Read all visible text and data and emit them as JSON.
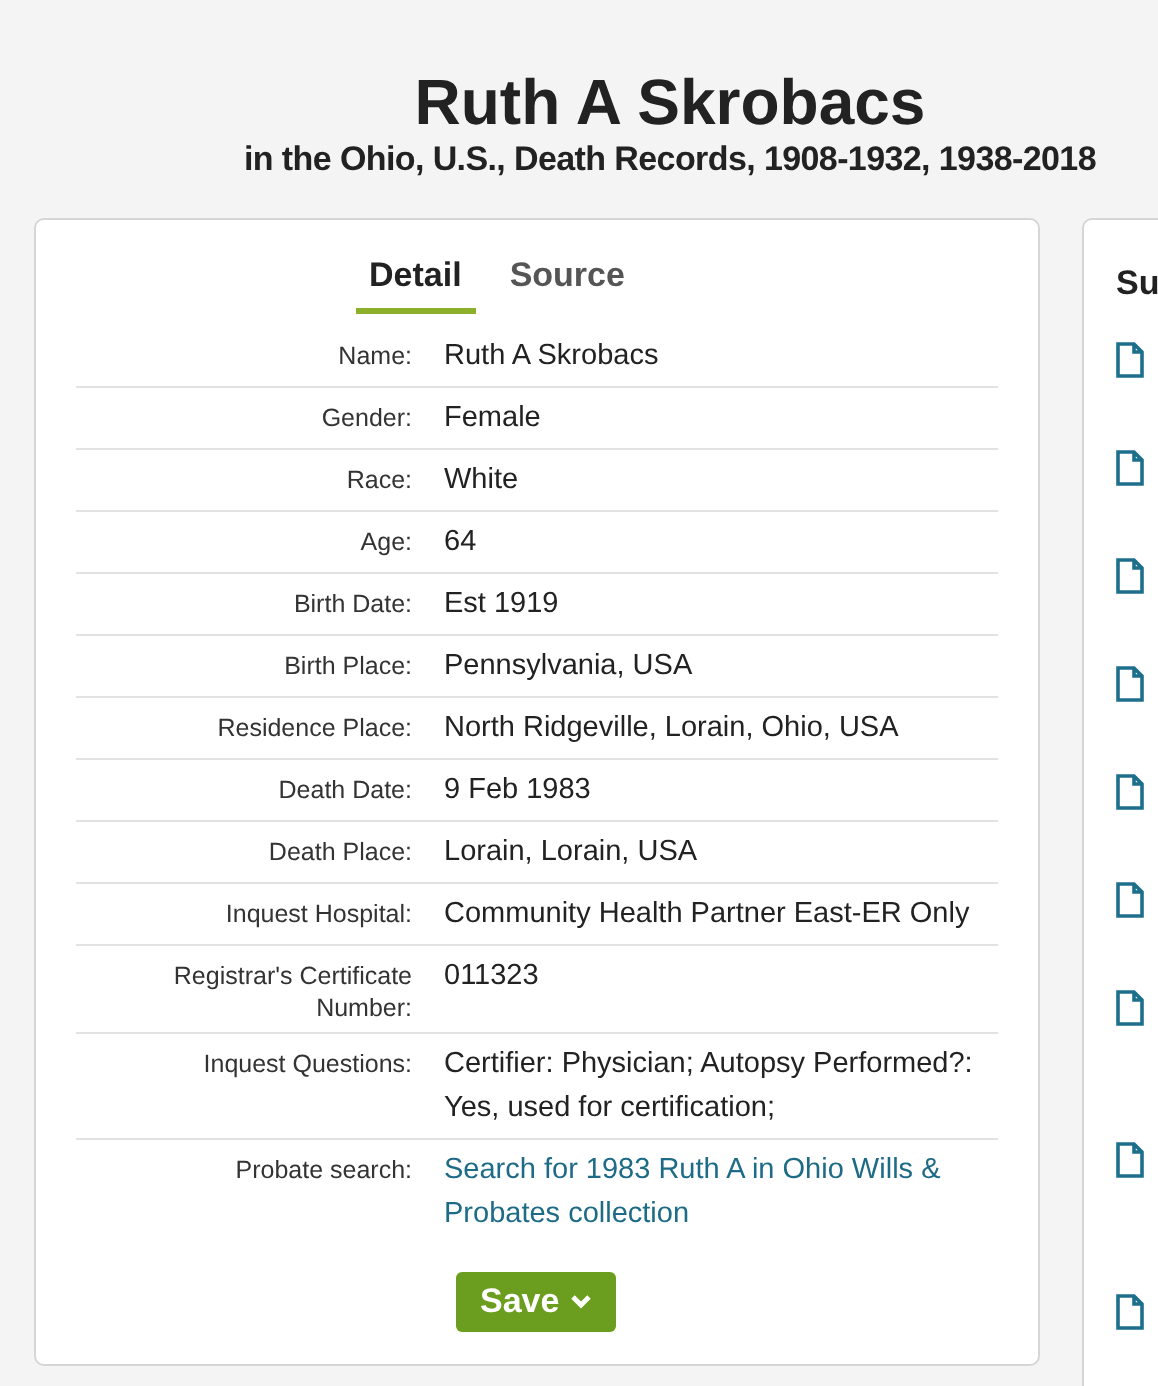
{
  "header": {
    "title": "Ruth A Skrobacs",
    "subtitle": "in the Ohio, U.S., Death Records, 1908-1932, 1938-2018"
  },
  "tabs": [
    {
      "label": "Detail",
      "selected": true
    },
    {
      "label": "Source",
      "selected": false
    }
  ],
  "fields": [
    {
      "label": "Name:",
      "value": "Ruth A Skrobacs",
      "kind": "text"
    },
    {
      "label": "Gender:",
      "value": "Female",
      "kind": "text"
    },
    {
      "label": "Race:",
      "value": "White",
      "kind": "text"
    },
    {
      "label": "Age:",
      "value": "64",
      "kind": "text"
    },
    {
      "label": "Birth Date:",
      "value": "Est 1919",
      "kind": "text"
    },
    {
      "label": "Birth Place:",
      "value": "Pennsylvania, USA",
      "kind": "text"
    },
    {
      "label": "Residence Place:",
      "value": "North Ridgeville, Lorain, Ohio, USA",
      "kind": "text"
    },
    {
      "label": "Death Date:",
      "value": "9 Feb 1983",
      "kind": "text"
    },
    {
      "label": "Death Place:",
      "value": "Lorain, Lorain, USA",
      "kind": "text"
    },
    {
      "label": "Inquest Hospital:",
      "value": "Community Health Partner East-ER Only",
      "kind": "text"
    },
    {
      "label": "Registrar's Certificate Number:",
      "value": "011323",
      "kind": "text"
    },
    {
      "label": "Inquest Questions:",
      "value": "Certifier: Physician; Autopsy Performed?: Yes, used for certification;",
      "kind": "text"
    },
    {
      "label": "Probate search:",
      "value": "Search for 1983 Ruth A in Ohio Wills & Probates collection",
      "kind": "link"
    }
  ],
  "save_button": {
    "label": "Save"
  },
  "side_panel": {
    "heading": "Su",
    "items": [
      {
        "kind": "document"
      },
      {
        "kind": "document"
      },
      {
        "kind": "document"
      },
      {
        "kind": "document"
      },
      {
        "kind": "document"
      },
      {
        "kind": "document"
      },
      {
        "kind": "document"
      },
      {
        "kind": "document"
      },
      {
        "kind": "document"
      }
    ]
  }
}
